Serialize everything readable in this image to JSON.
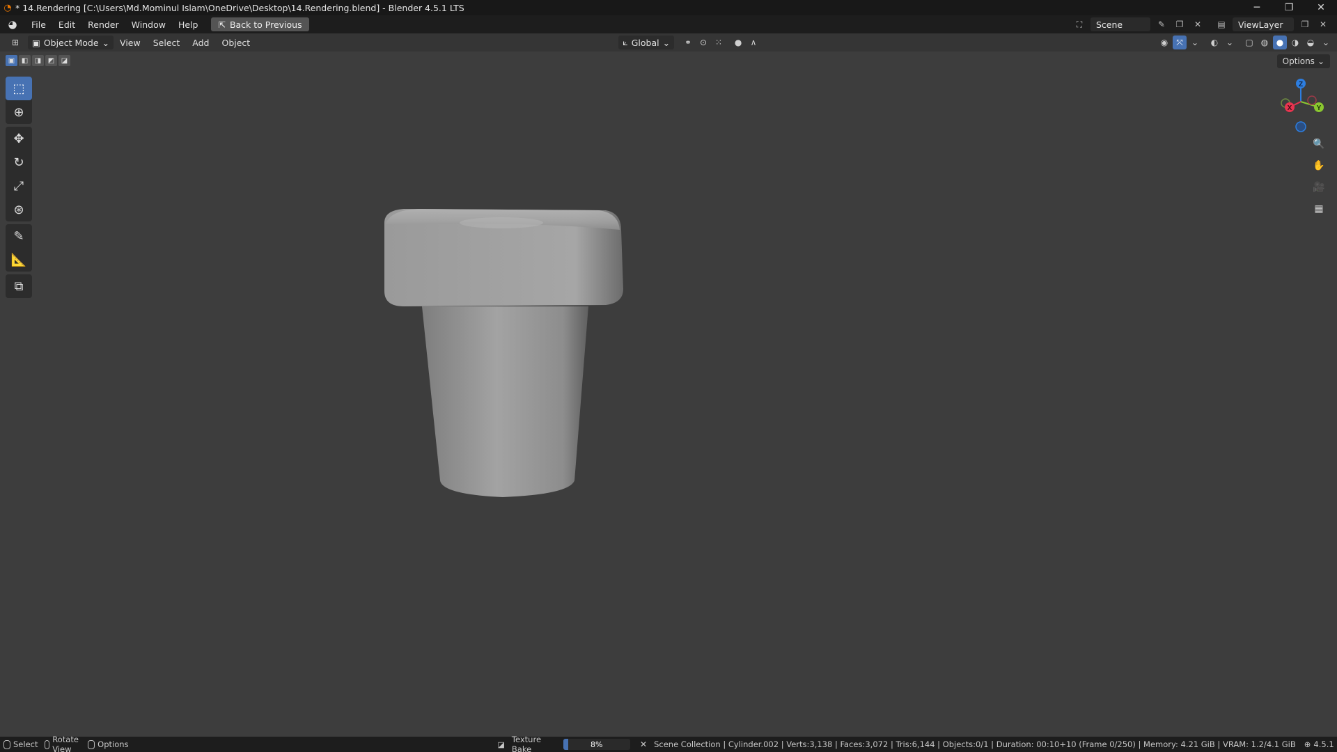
{
  "window": {
    "title": "* 14.Rendering [C:\\Users\\Md.Mominul Islam\\OneDrive\\Desktop\\14.Rendering.blend] - Blender 4.5.1 LTS",
    "minimize": "─",
    "restore": "❐",
    "close": "✕"
  },
  "menu": {
    "file": "File",
    "edit": "Edit",
    "render": "Render",
    "window": "Window",
    "help": "Help",
    "back_to_previous": "Back to Previous"
  },
  "scene": {
    "name": "Scene",
    "view_layer": "ViewLayer"
  },
  "viewport_header": {
    "mode": "Object Mode",
    "view": "View",
    "select": "Select",
    "add": "Add",
    "object": "Object",
    "orientation": "Global",
    "options": "Options"
  },
  "gizmo": {
    "z": "Z",
    "x": "X",
    "y": "Y"
  },
  "status": {
    "select": "Select",
    "rotate_view": "Rotate View",
    "options": "Options",
    "job_label": "Texture Bake",
    "progress": 8,
    "progress_text": "8%",
    "stats": "Scene Collection | Cylinder.002 | Verts:3,138 | Faces:3,072 | Tris:6,144 | Objects:0/1 | Duration: 00:10+10 (Frame 0/250) | Memory: 4.21 GiB | VRAM: 1.2/4.1 GiB",
    "version": "4.5.1"
  },
  "colors": {
    "accent": "#4772b3",
    "viewport_bg": "#3d3d3d",
    "axis_x": "#e8344f",
    "axis_y": "#8ac730",
    "axis_z": "#2d7ee0"
  }
}
